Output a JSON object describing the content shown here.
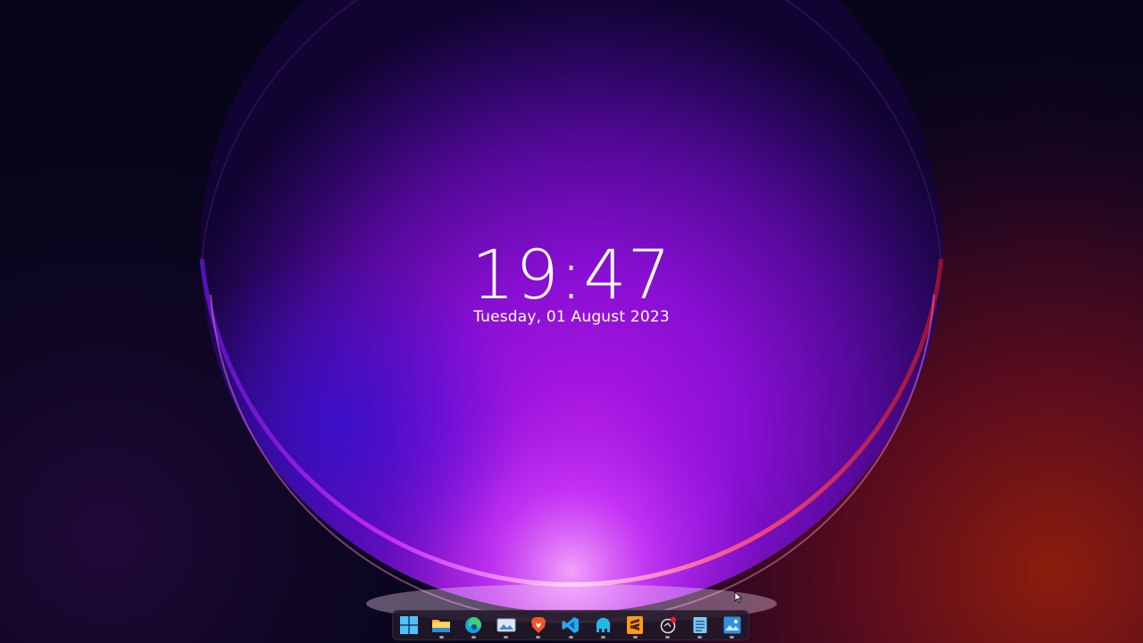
{
  "clock": {
    "time": "19:47",
    "date": "Tuesday, 01 August 2023"
  },
  "taskbar": {
    "items": [
      {
        "name": "start",
        "icon": "windows-logo-icon",
        "running": false
      },
      {
        "name": "file-explorer",
        "icon": "folder-icon",
        "running": true
      },
      {
        "name": "edge",
        "icon": "edge-browser-icon",
        "running": true
      },
      {
        "name": "photos",
        "icon": "photos-icon",
        "running": true
      },
      {
        "name": "brave",
        "icon": "brave-browser-icon",
        "running": true
      },
      {
        "name": "vscode",
        "icon": "vscode-icon",
        "running": true
      },
      {
        "name": "app-blue",
        "icon": "elephant-icon",
        "running": true
      },
      {
        "name": "sublime-text",
        "icon": "sublime-text-icon",
        "running": true
      },
      {
        "name": "app-circle",
        "icon": "circle-app-icon",
        "running": true
      },
      {
        "name": "notepad",
        "icon": "notepad-icon",
        "running": true
      },
      {
        "name": "photo-viewer",
        "icon": "image-viewer-icon",
        "running": true
      }
    ]
  },
  "colors": {
    "background": "#07051a",
    "wallpaper_core": "#a012d8",
    "wallpaper_edge": "#ff2d6a",
    "wallpaper_glow_right": "#9a1a10",
    "clock_text": "#ffffff",
    "taskbar_bg": "#221828"
  }
}
